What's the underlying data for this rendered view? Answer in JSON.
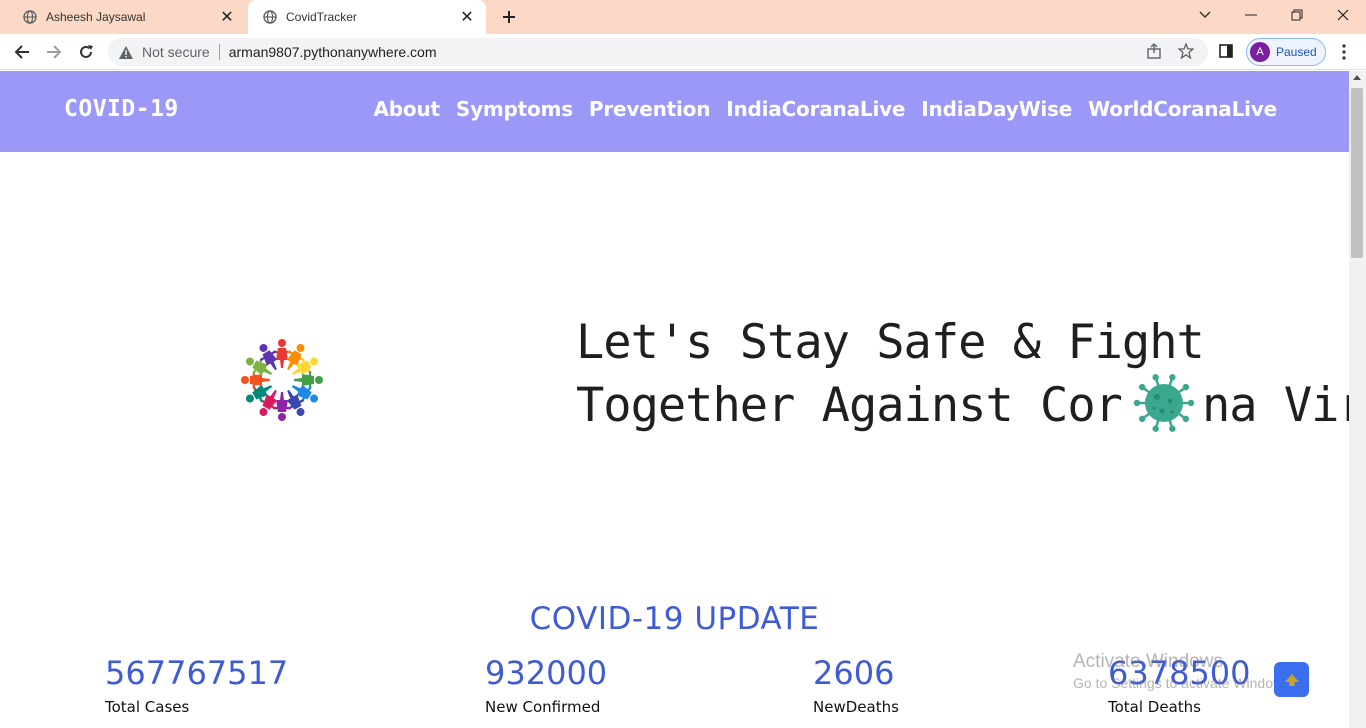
{
  "browser": {
    "tabs": [
      {
        "title": "Asheesh Jaysawal",
        "active": false
      },
      {
        "title": "CovidTracker",
        "active": true
      }
    ],
    "address": {
      "security_label": "Not secure",
      "url": "arman9807.pythonanywhere.com"
    },
    "profile": {
      "initial": "A",
      "status": "Paused",
      "avatar_color": "#7b1fa2"
    }
  },
  "site": {
    "brand": "COVID-19",
    "nav": [
      "About",
      "Symptoms",
      "Prevention",
      "IndiaCoranaLive",
      "IndiaDayWise",
      "WorldCoranaLive"
    ],
    "nav_bg": "#9c98f8"
  },
  "hero": {
    "line1": "Let's Stay Safe & Fight",
    "line2_before": "Together Against Cor",
    "line2_after": "na Virus"
  },
  "update": {
    "title": "COVID-19 UPDATE",
    "stats": [
      {
        "value": "567767517",
        "label": "Total Cases"
      },
      {
        "value": "932000",
        "label": "New Confirmed"
      },
      {
        "value": "2606",
        "label": "NewDeaths"
      },
      {
        "value": "6378500",
        "label": "Total Deaths"
      }
    ],
    "accent": "#3f5bd6"
  },
  "os_watermark": {
    "line1": "Activate Windows",
    "line2": "Go to Settings to activate Windows."
  }
}
